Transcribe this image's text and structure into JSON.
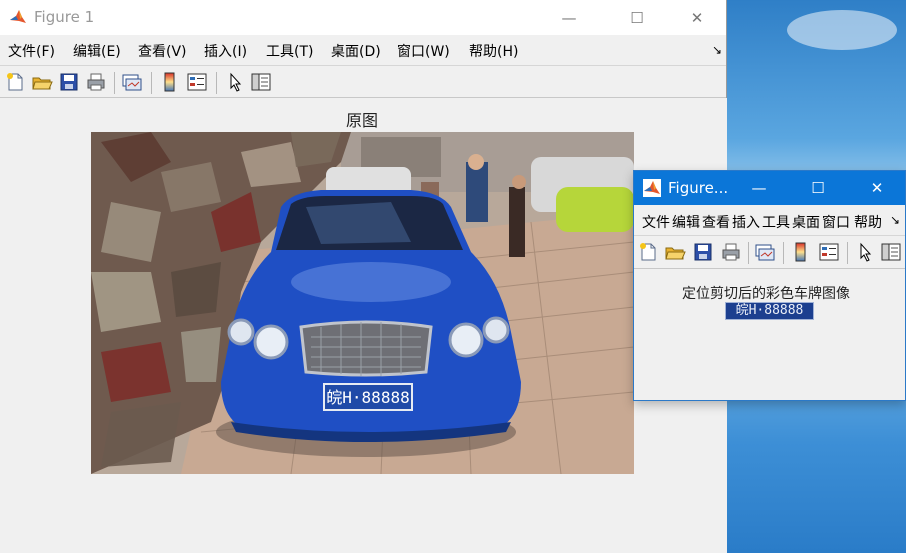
{
  "desktop": {
    "background": "#3a8fd0"
  },
  "figure1": {
    "title": "Figure 1",
    "menu": [
      "文件(F)",
      "编辑(E)",
      "查看(V)",
      "插入(I)",
      "工具(T)",
      "桌面(D)",
      "窗口(W)",
      "帮助(H)"
    ],
    "dock_arrow": "↘",
    "axes_title": "原图",
    "image": {
      "plate_text": "皖H·88888",
      "car_color": "#1f4fc4"
    }
  },
  "figure2": {
    "title": "Figure...",
    "menu": [
      "文件",
      "编辑",
      "查看",
      "插入",
      "工具",
      "桌面",
      "窗口",
      "帮助"
    ],
    "dock_arrow": "↘",
    "axes_title": "定位剪切后的彩色车牌图像",
    "plate_text": "皖H·88888"
  },
  "captions": {
    "minimize": "—",
    "maximize": "☐",
    "close": "✕"
  }
}
